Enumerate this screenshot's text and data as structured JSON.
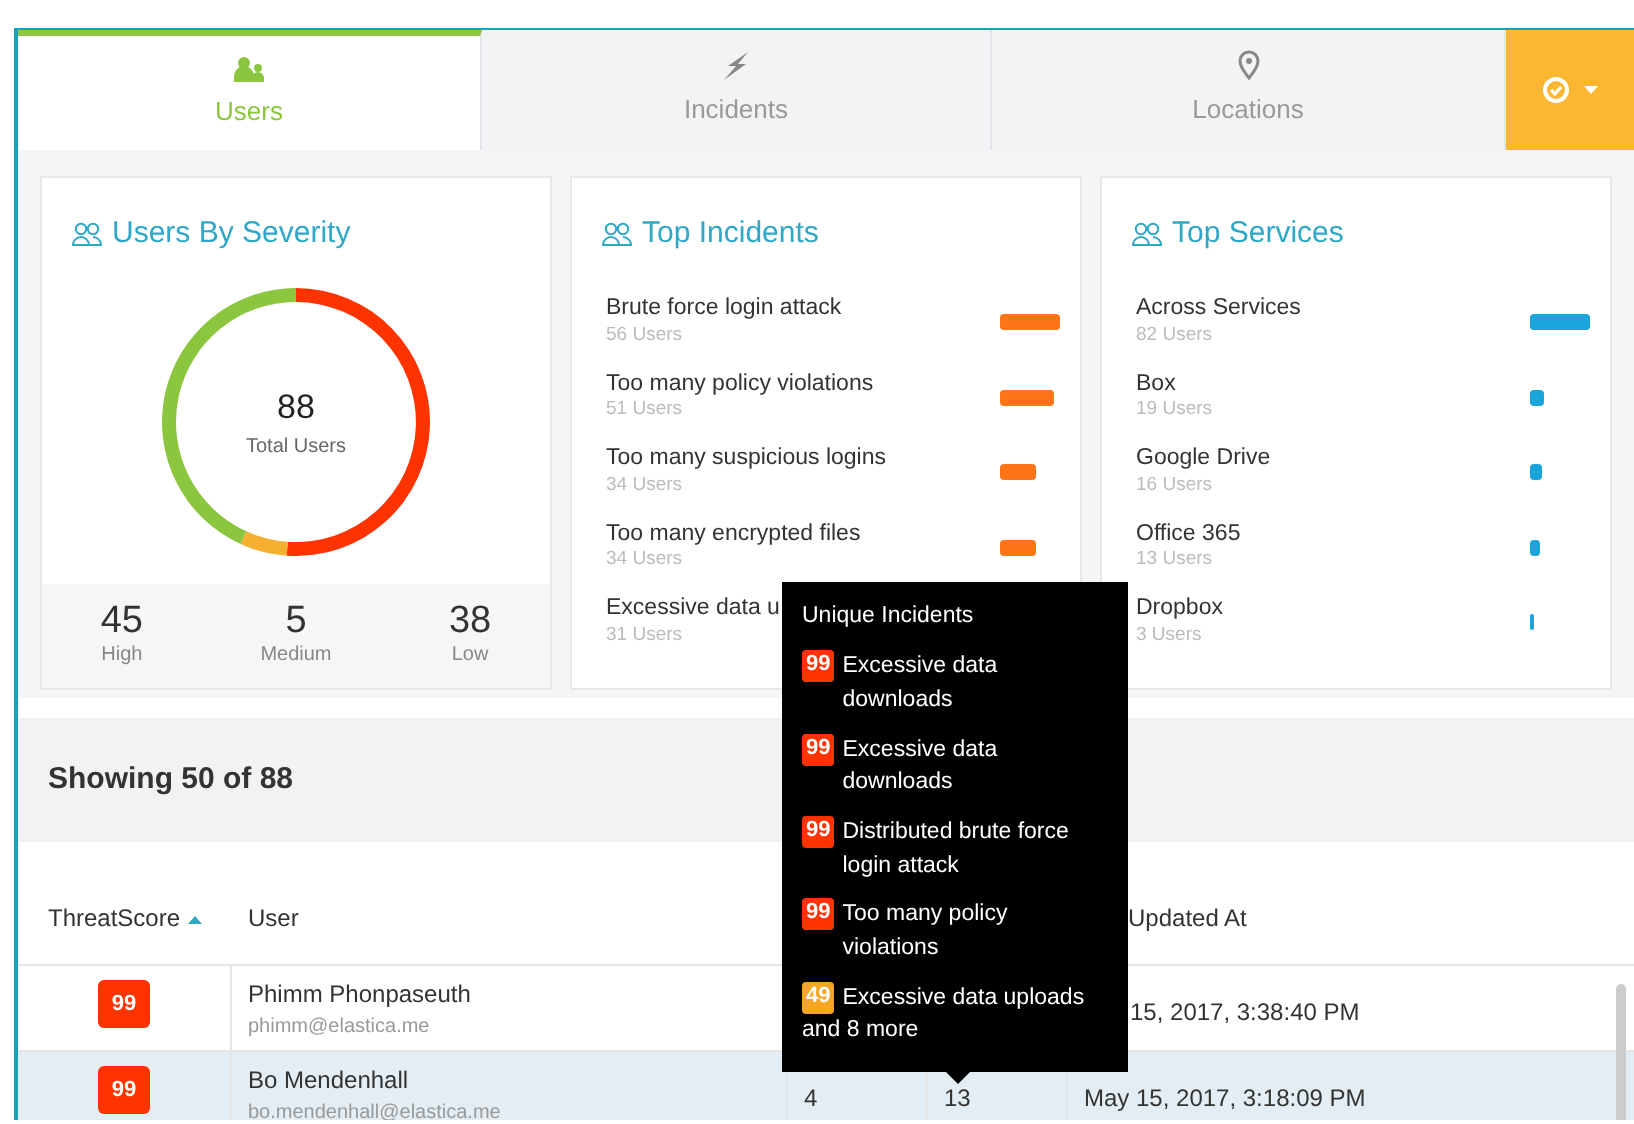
{
  "tabs": [
    {
      "label": "Users",
      "selected": true
    },
    {
      "label": "Incidents",
      "selected": false
    },
    {
      "label": "Locations",
      "selected": false
    }
  ],
  "severity": {
    "title": "Users By Severity",
    "total": "88",
    "total_label": "Total Users",
    "chart_data": {
      "type": "donut",
      "categories": [
        "High",
        "Medium",
        "Low"
      ],
      "series": [
        {
          "values": [
            51.1,
            5.7,
            43.2
          ]
        }
      ],
      "colors": [
        "#ff3300",
        "#f5b031",
        "#8cc63f"
      ]
    },
    "stats": [
      {
        "value": "45"
      },
      {
        "value": "5"
      },
      {
        "value": "38"
      }
    ]
  },
  "top_incidents": {
    "title": "Top Incidents",
    "items": [
      {
        "name": "Brute force login attack",
        "users": "56 Users"
      },
      {
        "name": "Too many policy violations",
        "users": "51 Users"
      },
      {
        "name": "Too many suspicious logins",
        "users": "34 Users"
      },
      {
        "name": "Too many encrypted files",
        "users": "34 Users"
      },
      {
        "name": "Excessive data u",
        "users": "31 Users"
      }
    ]
  },
  "top_services": {
    "title": "Top Services",
    "items": [
      {
        "name": "Across Services",
        "users": "82 Users"
      },
      {
        "name": "Box",
        "users": "19 Users"
      },
      {
        "name": "Google Drive",
        "users": "16 Users"
      },
      {
        "name": "Office 365",
        "users": "13 Users"
      },
      {
        "name": "Dropbox",
        "users": "3 Users"
      }
    ]
  },
  "showing": "Showing 50 of 88",
  "table": {
    "columns": [
      {
        "label": "ThreatScore",
        "sorted": true
      },
      {
        "label": "User"
      },
      {
        "label": "Updated At"
      }
    ],
    "rows": [
      {
        "score": "99",
        "name": "Phimm Phonpaseuth",
        "email": "phimm@elastica.me",
        "updated_at": "15, 2017, 3:38:40 PM",
        "selected": false
      },
      {
        "score": "99",
        "name": "Bo Mendenhall",
        "email": "bo.mendenhall@elastica.me",
        "column_3": "4",
        "column_4": "13",
        "updated_at": "May 15, 2017, 3:18:09 PM",
        "selected": true
      }
    ]
  },
  "tooltip": {
    "title": "Unique Incidents",
    "items": [
      {
        "score": "99",
        "text": "Excessive data downloads",
        "color": "#ff3300"
      },
      {
        "score": "99",
        "text": "Excessive data downloads",
        "color": "#ff3300"
      },
      {
        "score": "99",
        "text": "Distributed brute force login attack",
        "color": "#ff3300"
      },
      {
        "score": "99",
        "text": "Too many policy violations",
        "color": "#ff3300"
      },
      {
        "score": "49",
        "text": "Excessive data uploads",
        "color": "#f5a623"
      }
    ],
    "more": "and 8 more"
  }
}
